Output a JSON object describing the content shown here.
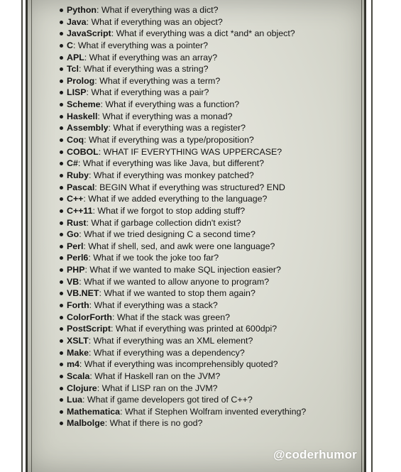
{
  "items": [
    {
      "lang": "Python",
      "text": ": What if everything was a dict?"
    },
    {
      "lang": "Java",
      "text": ": What if everything was an object?"
    },
    {
      "lang": "JavaScript",
      "text": ": What if everything was a dict *and* an object?"
    },
    {
      "lang": "C",
      "text": ": What if everything was a pointer?"
    },
    {
      "lang": "APL",
      "text": ": What if everything was an array?"
    },
    {
      "lang": "Tcl",
      "text": ": What if everything was a string?"
    },
    {
      "lang": "Prolog",
      "text": ": What if everything was a term?"
    },
    {
      "lang": "LISP",
      "text": ": What if everything was a pair?"
    },
    {
      "lang": "Scheme",
      "text": ": What if everything was a function?"
    },
    {
      "lang": "Haskell",
      "text": ": What if everything was a monad?"
    },
    {
      "lang": "Assembly",
      "text": ": What if everything was a register?"
    },
    {
      "lang": "Coq",
      "text": ": What if everything was a type/proposition?"
    },
    {
      "lang": "COBOL",
      "text": ": WHAT IF EVERYTHING WAS UPPERCASE?"
    },
    {
      "lang": "C#",
      "text": ": What if everything was like Java, but different?"
    },
    {
      "lang": "Ruby",
      "text": ": What if everything was monkey patched?"
    },
    {
      "lang": "Pascal",
      "text": ": BEGIN What if everything was structured? END"
    },
    {
      "lang": "C++",
      "text": ": What if we added everything to the language?"
    },
    {
      "lang": "C++11",
      "text": ": What if we forgot to stop adding stuff?"
    },
    {
      "lang": "Rust",
      "text": ": What if garbage collection didn't exist?"
    },
    {
      "lang": "Go",
      "text": ": What if we tried designing C a second time?"
    },
    {
      "lang": "Perl",
      "text": ": What if shell, sed, and awk were one language?"
    },
    {
      "lang": "Perl6",
      "text": ": What if we took the joke too far?"
    },
    {
      "lang": "PHP",
      "text": ": What if we wanted to make SQL injection easier?"
    },
    {
      "lang": "VB",
      "text": ": What if we wanted to allow anyone to program?"
    },
    {
      "lang": "VB.NET",
      "text": ": What if we wanted to stop them again?"
    },
    {
      "lang": "Forth",
      "text": ": What if everything was a stack?"
    },
    {
      "lang": "ColorForth",
      "text": ": What if the stack was green?"
    },
    {
      "lang": "PostScript",
      "text": ": What if everything was printed at 600dpi?"
    },
    {
      "lang": "XSLT",
      "text": ": What if everything was an XML element?"
    },
    {
      "lang": "Make",
      "text": ": What if everything was a dependency?"
    },
    {
      "lang": "m4",
      "text": ": What if everything was incomprehensibly quoted?"
    },
    {
      "lang": "Scala",
      "text": ": What if Haskell ran on the JVM?"
    },
    {
      "lang": "Clojure",
      "text": ": What if LISP ran on the JVM?"
    },
    {
      "lang": "Lua",
      "text": ": What if game developers got tired of C++?"
    },
    {
      "lang": "Mathematica",
      "text": ": What if Stephen Wolfram invented everything?"
    },
    {
      "lang": "Malbolge",
      "text": ": What if there is no god?"
    }
  ],
  "watermark": "@coderhumor",
  "colors": {
    "board": "#d9dad0",
    "frame_line": "#3e3e36",
    "text": "#141414",
    "watermark": "#ffffff"
  }
}
